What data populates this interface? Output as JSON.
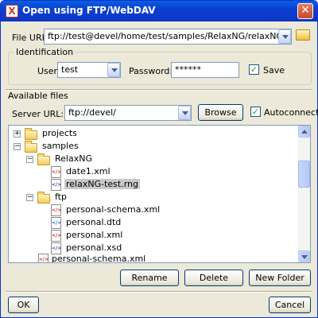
{
  "window": {
    "title": "Open using FTP/WebDAV",
    "app_icon": "x-letter-icon",
    "close_icon": "close-icon"
  },
  "file_url": {
    "label": "File URL:",
    "value": "ftp://test@devel/home/test/samples/RelaxNG/relaxNG-test.rng",
    "browse_icon": "folder-open-icon"
  },
  "identification": {
    "title": "Identification",
    "user_label": "User:",
    "user_value": "test",
    "password_label": "Password:",
    "password_value": "******",
    "save_label": "Save",
    "save_checked": true
  },
  "available_files": {
    "title": "Available files",
    "server_url_label": "Server URL:",
    "server_url_value": "ftp://devel/",
    "browse_button": "Browse",
    "autoconnect_label": "Autoconnect",
    "autoconnect_checked": true
  },
  "tree": [
    {
      "label": "projects",
      "type": "folder",
      "expanded": false
    },
    {
      "label": "samples",
      "type": "folder",
      "expanded": true
    },
    {
      "label": "RelaxNG",
      "type": "folder",
      "expanded": true
    },
    {
      "label": "date1.xml",
      "type": "xml-file"
    },
    {
      "label": "relaxNG-test.rng",
      "type": "rng-file",
      "selected": true
    },
    {
      "label": "ftp",
      "type": "folder",
      "expanded": true
    },
    {
      "label": "personal-schema.xml",
      "type": "xml-file"
    },
    {
      "label": "personal.dtd",
      "type": "dtd-file"
    },
    {
      "label": "personal.xml",
      "type": "xml-file"
    },
    {
      "label": "personal.xsd",
      "type": "xsd-file"
    },
    {
      "label": "personal-schema.xml",
      "type": "xml-file"
    }
  ],
  "file_buttons": {
    "rename": "Rename",
    "delete": "Delete",
    "new_folder": "New Folder"
  },
  "dialog_buttons": {
    "ok": "OK",
    "cancel": "Cancel"
  },
  "colors": {
    "titlebar": "#0a3fd0",
    "dialog_bg": "#ece9d8",
    "selection": "#c9c9c9"
  }
}
